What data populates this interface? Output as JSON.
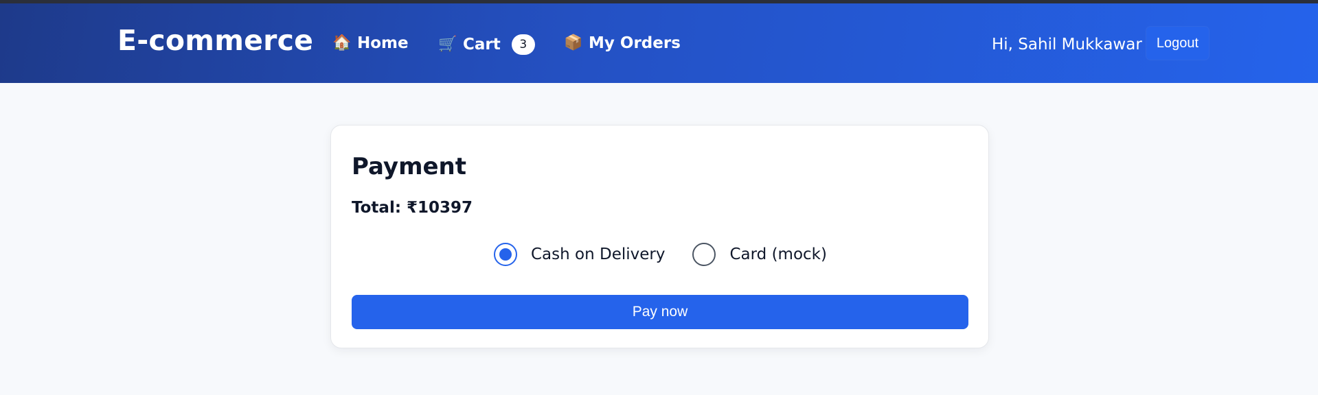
{
  "navbar": {
    "brand": "E-commerce",
    "items": [
      {
        "label": "Home",
        "icon": "house-icon",
        "glyph": "🏠"
      },
      {
        "label": "Cart",
        "icon": "cart-icon",
        "glyph": "🛒",
        "badge": "3"
      },
      {
        "label": "My Orders",
        "icon": "package-icon",
        "glyph": "📦"
      }
    ],
    "greeting": "Hi, Sahil Mukkawar",
    "logout_label": "Logout"
  },
  "payment": {
    "title": "Payment",
    "total": "Total: ₹10397",
    "options": [
      {
        "label": "Cash on Delivery",
        "selected": true
      },
      {
        "label": "Card (mock)",
        "selected": false
      }
    ],
    "pay_label": "Pay now"
  },
  "colors": {
    "accent": "#2563eb",
    "nav_gradient_start": "#1e3a8a",
    "nav_gradient_end": "#2563eb",
    "page_background": "#f7f9fc",
    "text_dark": "#0f172a"
  }
}
